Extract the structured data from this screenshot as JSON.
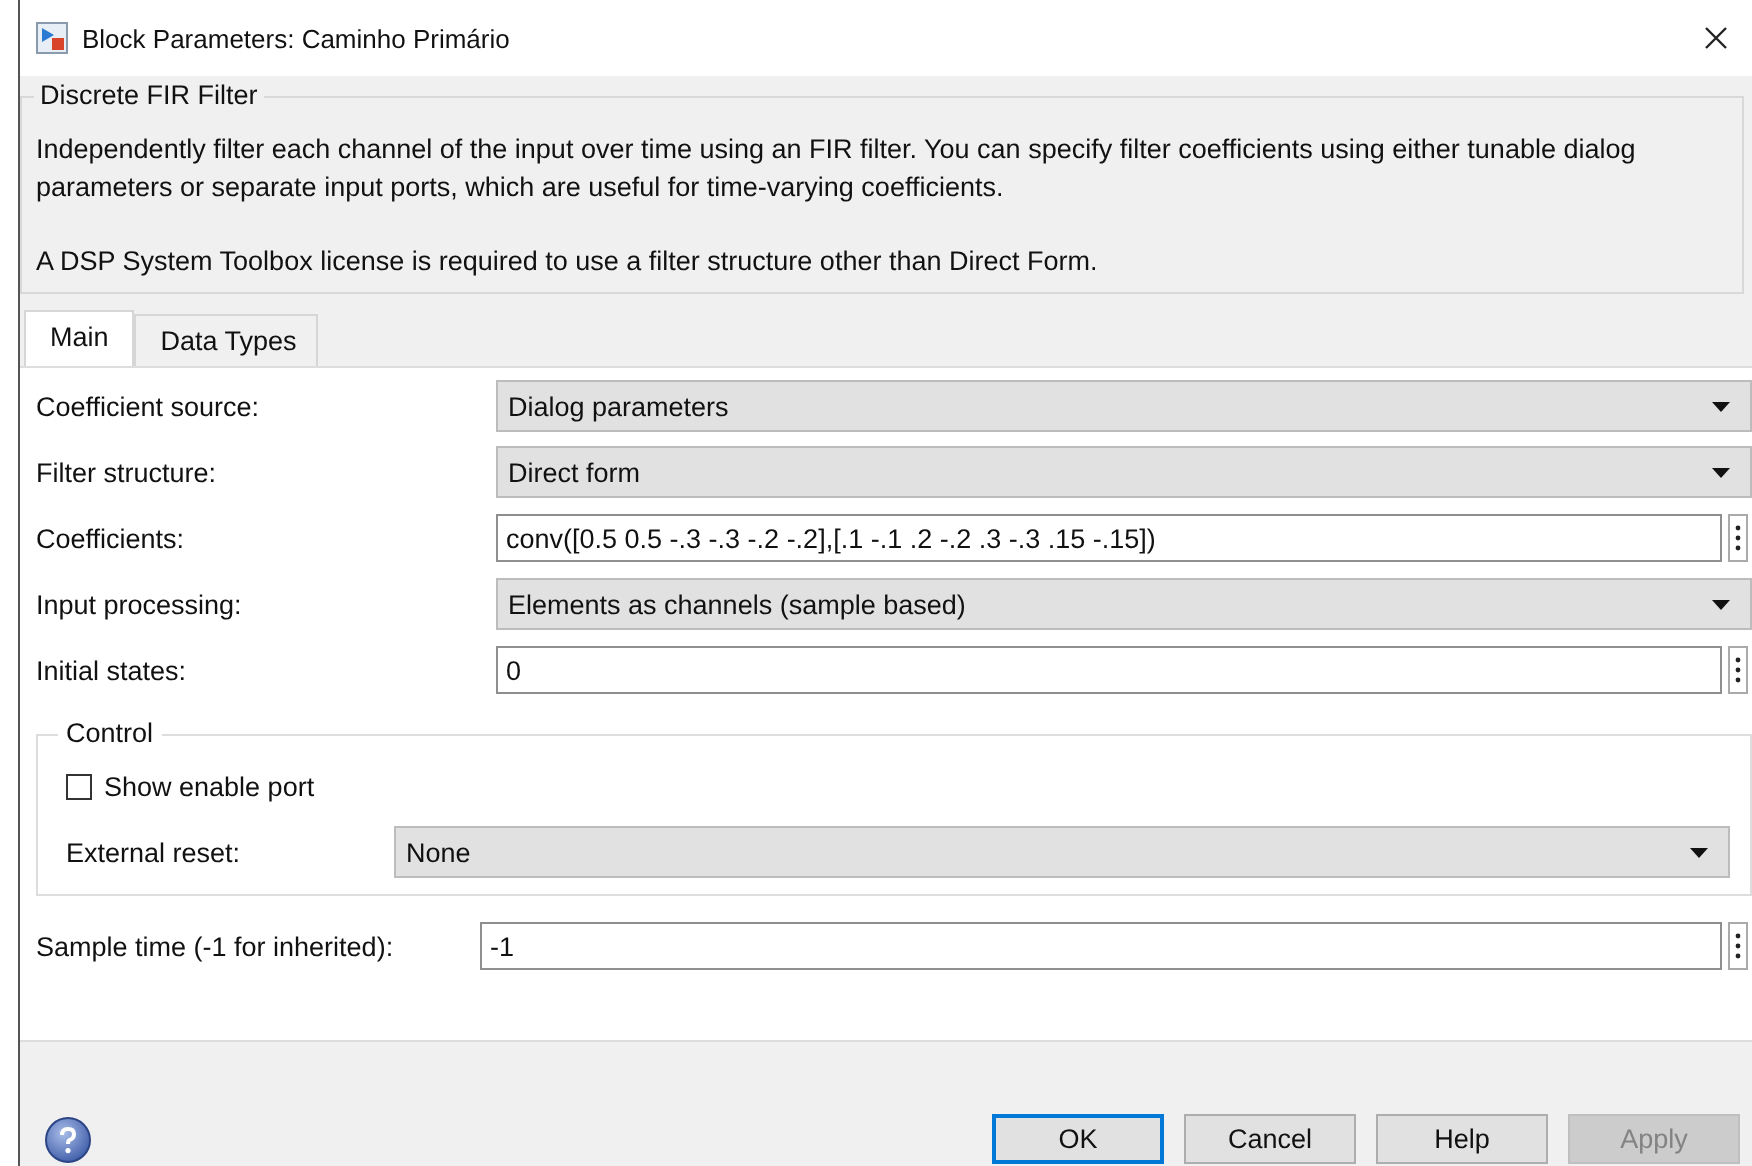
{
  "window": {
    "title": "Block Parameters: Caminho Primário"
  },
  "group": {
    "title": "Discrete FIR Filter",
    "paragraphs": [
      "Independently filter each channel of the input over time using an FIR filter. You can specify filter coefficients using either tunable dialog parameters or separate input ports, which are useful for time-varying coefficients.",
      "A DSP System Toolbox license is required to use a filter structure other than Direct Form."
    ]
  },
  "tabs": [
    {
      "label": "Main",
      "selected": true
    },
    {
      "label": "Data Types",
      "selected": false
    }
  ],
  "parameters": [
    {
      "label": "Coefficient source:",
      "kind": "dropdown",
      "value": "Dialog parameters"
    },
    {
      "label": "Filter structure:",
      "kind": "dropdown",
      "value": "Direct form"
    },
    {
      "label": "Coefficients:",
      "kind": "edit",
      "value": "conv([0.5 0.5 -.3 -.3 -.2 -.2],[.1 -.1 .2 -.2 .3 -.3 .15 -.15])"
    },
    {
      "label": "Input processing:",
      "kind": "dropdown",
      "value": "Elements as channels (sample based)"
    },
    {
      "label": "Initial states:",
      "kind": "edit",
      "value": "0"
    }
  ],
  "control": {
    "title": "Control",
    "checkbox": {
      "label": "Show enable port",
      "checked": false
    },
    "reset": {
      "label": "External reset:",
      "value": "None"
    }
  },
  "sample_time": {
    "label": "Sample time (-1 for inherited):",
    "value": "-1"
  },
  "buttons": [
    {
      "label": "OK",
      "default": true,
      "disabled": false
    },
    {
      "label": "Cancel",
      "default": false,
      "disabled": false
    },
    {
      "label": "Help",
      "default": false,
      "disabled": false
    },
    {
      "label": "Apply",
      "default": false,
      "disabled": true
    }
  ]
}
